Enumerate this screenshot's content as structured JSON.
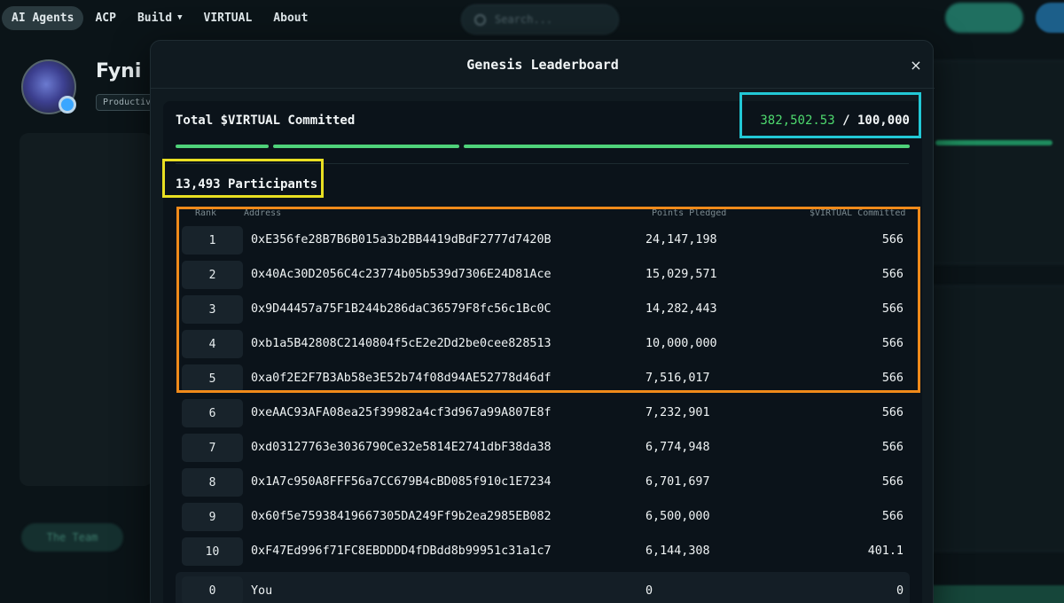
{
  "nav": {
    "items": [
      {
        "label": "AI Agents",
        "active": true
      },
      {
        "label": "ACP"
      },
      {
        "label": "Build",
        "has_caret": true
      },
      {
        "label": "VIRTUAL"
      },
      {
        "label": "About"
      }
    ],
    "search_placeholder": "Search..."
  },
  "background": {
    "agent_name": "Fyni",
    "tag": "Productiv",
    "team_tab": "The Team"
  },
  "modal": {
    "title": "Genesis Leaderboard",
    "close_glyph": "×",
    "total_label": "Total $VIRTUAL Committed",
    "total_committed": "382,502.53",
    "total_separator": "/",
    "total_target": "100,000",
    "participants": "13,493 Participants",
    "columns": {
      "rank": "Rank",
      "address": "Address",
      "points": "Points Pledged",
      "committed": "$VIRTUAL Committed"
    },
    "rows": [
      {
        "rank": "1",
        "address": "0xE356fe28B7B6B015a3b2BB4419dBdF2777d7420B",
        "points": "24,147,198",
        "committed": "566"
      },
      {
        "rank": "2",
        "address": "0x40Ac30D2056C4c23774b05b539d7306E24D81Ace",
        "points": "15,029,571",
        "committed": "566"
      },
      {
        "rank": "3",
        "address": "0x9D44457a75F1B244b286daC36579F8fc56c1Bc0C",
        "points": "14,282,443",
        "committed": "566"
      },
      {
        "rank": "4",
        "address": "0xb1a5B42808C2140804f5cE2e2Dd2be0cee828513",
        "points": "10,000,000",
        "committed": "566"
      },
      {
        "rank": "5",
        "address": "0xa0f2E2F7B3Ab58e3E52b74f08d94AE52778d46df",
        "points": "7,516,017",
        "committed": "566"
      },
      {
        "rank": "6",
        "address": "0xeAAC93AFA08ea25f39982a4cf3d967a99A807E8f",
        "points": "7,232,901",
        "committed": "566"
      },
      {
        "rank": "7",
        "address": "0xd03127763e3036790Ce32e5814E2741dbF38da38",
        "points": "6,774,948",
        "committed": "566"
      },
      {
        "rank": "8",
        "address": "0x1A7c950A8FFF56a7CC679B4cBD085f910c1E7234",
        "points": "6,701,697",
        "committed": "566"
      },
      {
        "rank": "9",
        "address": "0x60f5e75938419667305DA249Ff9b2ea2985EB082",
        "points": "6,500,000",
        "committed": "566"
      },
      {
        "rank": "10",
        "address": "0xF47Ed996f71FC8EBDDDD4fDBdd8b99951c31a1c7",
        "points": "6,144,308",
        "committed": "401.1"
      }
    ],
    "you_row": {
      "rank": "0",
      "address": "You",
      "points": "0",
      "committed": "0"
    }
  },
  "colors": {
    "accent_green": "#4ed96e",
    "highlight_cyan": "#22c8d6",
    "highlight_yellow": "#e9df22",
    "highlight_orange": "#f08a1a"
  }
}
